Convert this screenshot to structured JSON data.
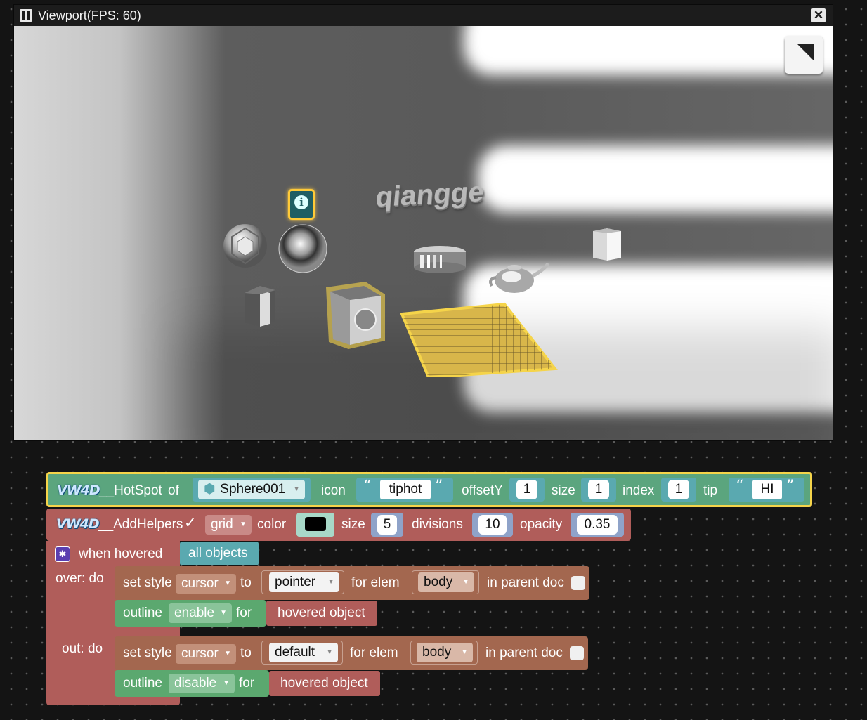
{
  "viewport": {
    "title": "Viewport(FPS: 60)",
    "scene_text": "qiangge"
  },
  "blocks": {
    "hotspot": {
      "logo": "VW4D",
      "name": "__HotSpot",
      "of_label": "of",
      "object": "Sphere001",
      "icon_label": "icon",
      "icon_value": "tiphot",
      "offsety_label": "offsetY",
      "offsety_value": "1",
      "size_label": "size",
      "size_value": "1",
      "index_label": "index",
      "index_value": "1",
      "tip_label": "tip",
      "tip_value": "HI"
    },
    "helpers": {
      "logo": "VW4D",
      "name": "__AddHelpers",
      "checked": "✓",
      "type": "grid",
      "color_label": "color",
      "color_value": "#000000",
      "size_label": "size",
      "size_value": "5",
      "divisions_label": "divisions",
      "divisions_value": "10",
      "opacity_label": "opacity",
      "opacity_value": "0.35"
    },
    "hover": {
      "when_label": "when hovered",
      "target": "all objects",
      "over_label": "over: do",
      "out_label": "out: do",
      "over_style": {
        "set_style": "set style",
        "property": "cursor",
        "to": "to",
        "value": "pointer",
        "for_elem": "for elem",
        "elem": "body",
        "in_parent": "in parent doc"
      },
      "over_outline": {
        "outline": "outline",
        "mode": "enable",
        "for": "for",
        "target": "hovered object"
      },
      "out_style": {
        "set_style": "set style",
        "property": "cursor",
        "to": "to",
        "value": "default",
        "for_elem": "for elem",
        "elem": "body",
        "in_parent": "in parent doc"
      },
      "out_outline": {
        "outline": "outline",
        "mode": "disable",
        "for": "for",
        "target": "hovered object"
      }
    }
  },
  "colors": {
    "hotspot_block": "#5ba57e",
    "selected_outline": "#f5d44a",
    "helpers_block": "#b05d5a",
    "value_block": "#5aa9b0",
    "style_block": "#a3674f",
    "outline_block": "#5ba86f"
  }
}
